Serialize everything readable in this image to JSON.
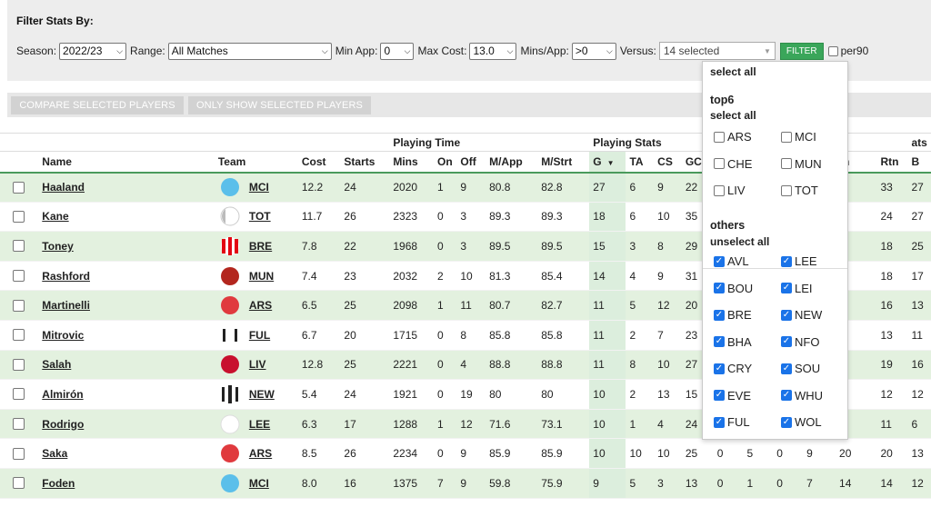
{
  "filters": {
    "title": "Filter Stats By:",
    "season_label": "Season:",
    "season_value": "2022/23",
    "range_label": "Range:",
    "range_value": "All Matches",
    "min_app_label": "Min App:",
    "min_app_value": "0",
    "max_cost_label": "Max Cost:",
    "max_cost_value": "13.0",
    "mins_app_label": "Mins/App:",
    "mins_app_value": ">0",
    "versus_label": "Versus:",
    "versus_value": "14 selected",
    "filter_button": "FILTER",
    "per90_label": "per90",
    "per90_checked": false
  },
  "actions": {
    "compare_label": "COMPARE SELECTED PLAYERS",
    "only_show_label": "ONLY SHOW SELECTED PLAYERS"
  },
  "versus_dropdown": {
    "select_all": "select all",
    "top6_title": "top6",
    "top6_select_all": "select all",
    "top6_teams": [
      {
        "code": "ARS",
        "checked": false
      },
      {
        "code": "MCI",
        "checked": false
      },
      {
        "code": "CHE",
        "checked": false
      },
      {
        "code": "MUN",
        "checked": false
      },
      {
        "code": "LIV",
        "checked": false
      },
      {
        "code": "TOT",
        "checked": false
      }
    ],
    "others_title": "others",
    "others_unselect_all": "unselect all",
    "other_teams": [
      {
        "code": "AVL",
        "checked": true
      },
      {
        "code": "LEE",
        "checked": true
      },
      {
        "code": "BOU",
        "checked": true
      },
      {
        "code": "LEI",
        "checked": true
      },
      {
        "code": "BRE",
        "checked": true
      },
      {
        "code": "NEW",
        "checked": true
      },
      {
        "code": "BHA",
        "checked": true
      },
      {
        "code": "NFO",
        "checked": true
      },
      {
        "code": "CRY",
        "checked": true
      },
      {
        "code": "SOU",
        "checked": true
      },
      {
        "code": "EVE",
        "checked": true
      },
      {
        "code": "WHU",
        "checked": true
      },
      {
        "code": "FUL",
        "checked": true
      },
      {
        "code": "WOL",
        "checked": true
      }
    ]
  },
  "table": {
    "group_headers": {
      "playing_time": "Playing Time",
      "playing_stats": "Playing Stats",
      "partial": "ats"
    },
    "columns": [
      "Name",
      "Team",
      "Cost",
      "Starts",
      "Mins",
      "On",
      "Off",
      "M/App",
      "M/Strt",
      "G",
      "TA",
      "CS",
      "GC",
      "",
      "",
      "",
      "",
      "tn",
      "Rtn",
      "B"
    ],
    "sort_indicator": "▼",
    "rows": [
      {
        "name": "Haaland",
        "team": "MCI",
        "kit": "sky",
        "cells": [
          "12.2",
          "24",
          "2020",
          "1",
          "9",
          "80.8",
          "82.8",
          "27",
          "6",
          "9",
          "22",
          "",
          "",
          "",
          "",
          "",
          "33",
          "27"
        ]
      },
      {
        "name": "Kane",
        "team": "TOT",
        "kit": "tot",
        "cells": [
          "11.7",
          "26",
          "2323",
          "0",
          "3",
          "89.3",
          "89.3",
          "18",
          "6",
          "10",
          "35",
          "",
          "",
          "",
          "",
          "",
          "24",
          "27"
        ]
      },
      {
        "name": "Toney",
        "team": "BRE",
        "kit": "bre",
        "cells": [
          "7.8",
          "22",
          "1968",
          "0",
          "3",
          "89.5",
          "89.5",
          "15",
          "3",
          "8",
          "29",
          "",
          "",
          "",
          "",
          "",
          "18",
          "25"
        ]
      },
      {
        "name": "Rashford",
        "team": "MUN",
        "kit": "mun",
        "cells": [
          "7.4",
          "23",
          "2032",
          "2",
          "10",
          "81.3",
          "85.4",
          "14",
          "4",
          "9",
          "31",
          "",
          "",
          "",
          "",
          "",
          "18",
          "17"
        ]
      },
      {
        "name": "Martinelli",
        "team": "ARS",
        "kit": "red",
        "cells": [
          "6.5",
          "25",
          "2098",
          "1",
          "11",
          "80.7",
          "82.7",
          "11",
          "5",
          "12",
          "20",
          "",
          "",
          "",
          "",
          "",
          "16",
          "13"
        ]
      },
      {
        "name": "Mitrovic",
        "team": "FUL",
        "kit": "ful",
        "cells": [
          "6.7",
          "20",
          "1715",
          "0",
          "8",
          "85.8",
          "85.8",
          "11",
          "2",
          "7",
          "23",
          "",
          "",
          "",
          "",
          "",
          "13",
          "11"
        ]
      },
      {
        "name": "Salah",
        "team": "LIV",
        "kit": "liv",
        "cells": [
          "12.8",
          "25",
          "2221",
          "0",
          "4",
          "88.8",
          "88.8",
          "11",
          "8",
          "10",
          "27",
          "",
          "",
          "",
          "",
          "",
          "19",
          "16"
        ]
      },
      {
        "name": "Almirón",
        "team": "NEW",
        "kit": "new",
        "cells": [
          "5.4",
          "24",
          "1921",
          "0",
          "19",
          "80",
          "80",
          "10",
          "2",
          "13",
          "15",
          "",
          "",
          "",
          "",
          "",
          "12",
          "12"
        ]
      },
      {
        "name": "Rodrigo",
        "team": "LEE",
        "kit": "white",
        "cells": [
          "6.3",
          "17",
          "1288",
          "1",
          "12",
          "71.6",
          "73.1",
          "10",
          "1",
          "4",
          "24",
          "",
          "",
          "",
          "",
          "",
          "11",
          "6"
        ]
      },
      {
        "name": "Saka",
        "team": "ARS",
        "kit": "red",
        "cells": [
          "8.5",
          "26",
          "2234",
          "0",
          "9",
          "85.9",
          "85.9",
          "10",
          "10",
          "10",
          "25",
          "0",
          "5",
          "0",
          "9",
          "20",
          "20",
          "13"
        ]
      },
      {
        "name": "Foden",
        "team": "MCI",
        "kit": "sky",
        "cells": [
          "8.0",
          "16",
          "1375",
          "7",
          "9",
          "59.8",
          "75.9",
          "9",
          "5",
          "3",
          "13",
          "0",
          "1",
          "0",
          "7",
          "14",
          "14",
          "12"
        ]
      }
    ]
  },
  "colors": {
    "accent_green": "#3aa65a",
    "row_alt": "#e3f1df",
    "check_blue": "#1a73e8"
  }
}
